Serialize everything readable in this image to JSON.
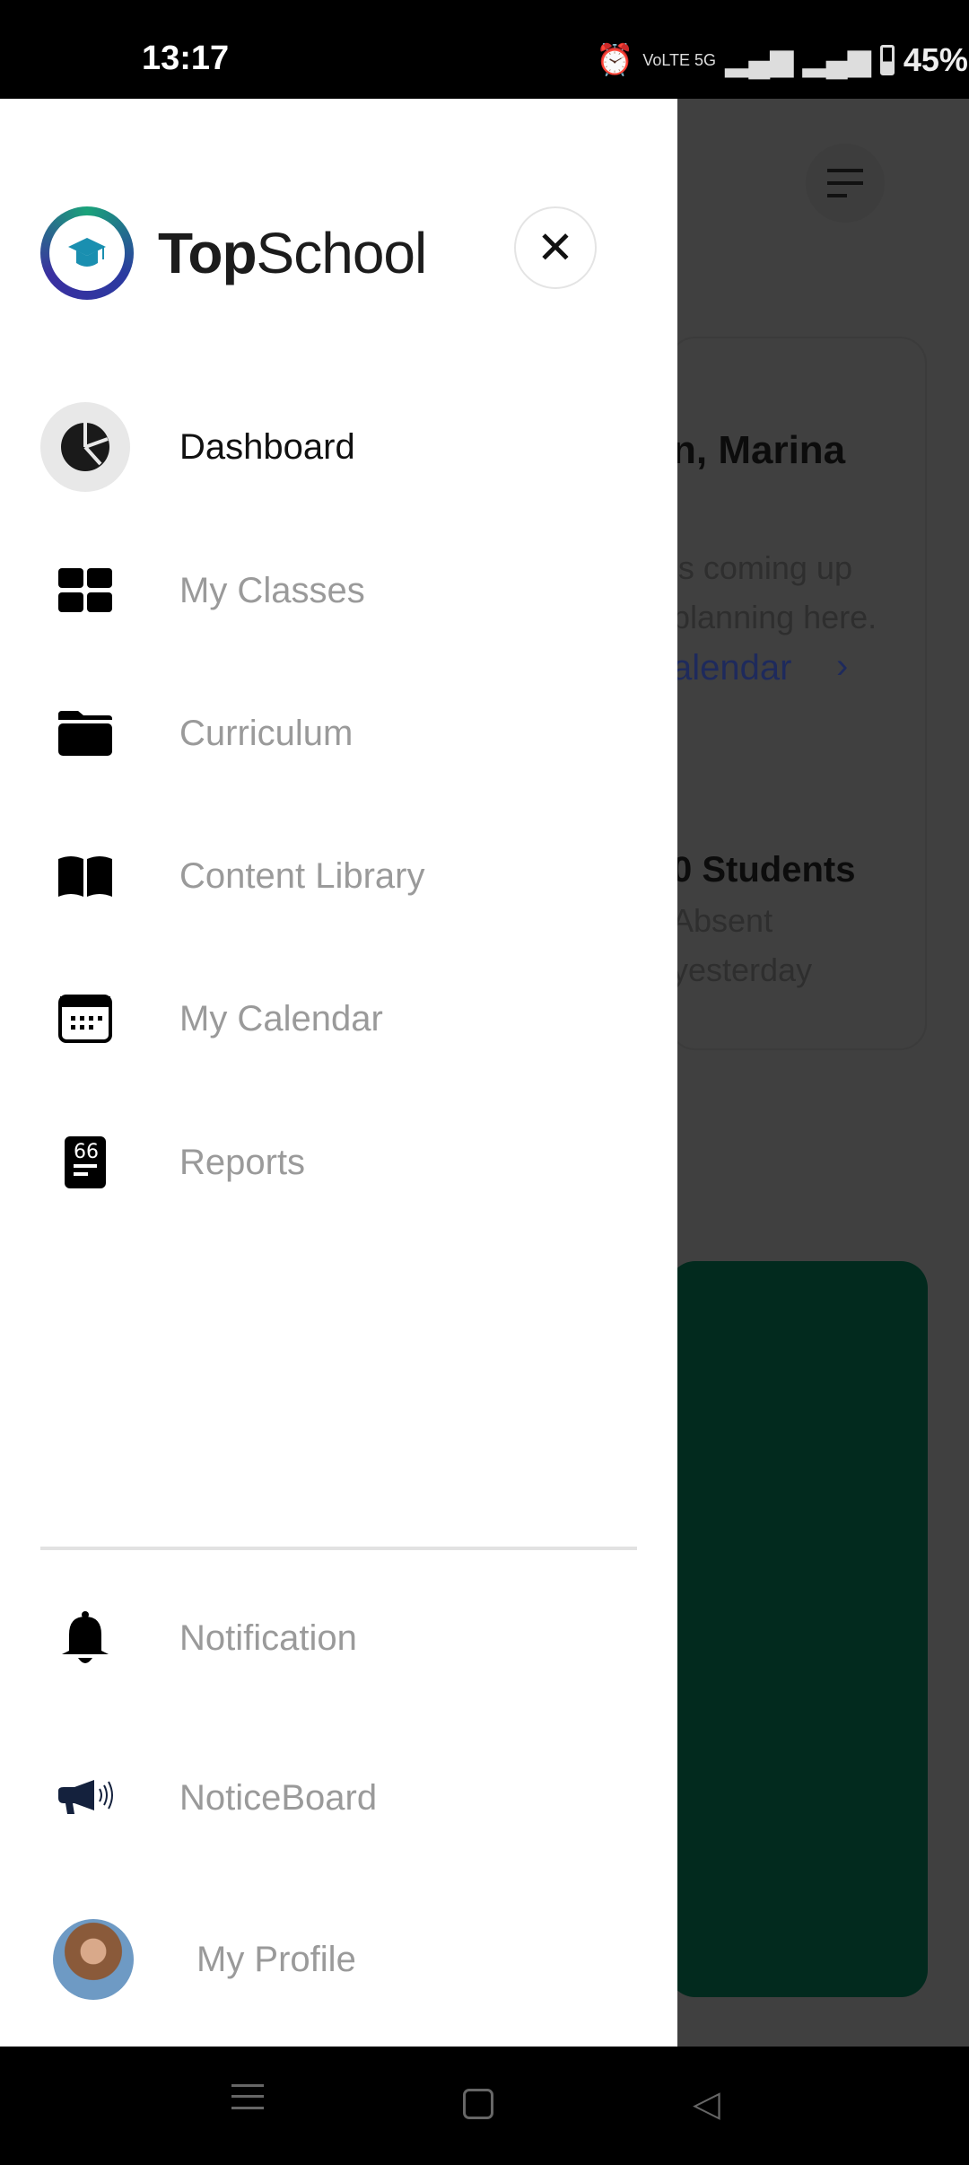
{
  "status_bar": {
    "time": "13:17",
    "network": "VoLTE 5G",
    "battery": "45%"
  },
  "drawer": {
    "brand_bold": "Top",
    "brand_regular": "School",
    "close_icon": "close-icon",
    "items": [
      {
        "label": "Dashboard",
        "icon": "pie-chart-icon",
        "active": true
      },
      {
        "label": "My Classes",
        "icon": "grid-icon"
      },
      {
        "label": "Curriculum",
        "icon": "folder-icon"
      },
      {
        "label": "Content Library",
        "icon": "book-icon"
      },
      {
        "label": "My Calendar",
        "icon": "calendar-icon"
      },
      {
        "label": "Reports",
        "icon": "report-icon"
      }
    ],
    "bottom_items": [
      {
        "label": "Notification",
        "icon": "bell-icon"
      },
      {
        "label": "NoticeBoard",
        "icon": "megaphone-icon"
      },
      {
        "label": "My Profile",
        "icon": "avatar"
      }
    ]
  },
  "background": {
    "greeting": "n, Marina",
    "line1": "'s coming up",
    "line2": "planning here.",
    "link": "alendar",
    "students": "0 Students",
    "absent": "Absent",
    "yesterday": "yesterday"
  },
  "colors": {
    "overlay": "#404040",
    "link": "#1e2a5c",
    "green_card": "#022a1e",
    "brand_teal": "#1aa37a",
    "cap": "#1a8fb0"
  }
}
